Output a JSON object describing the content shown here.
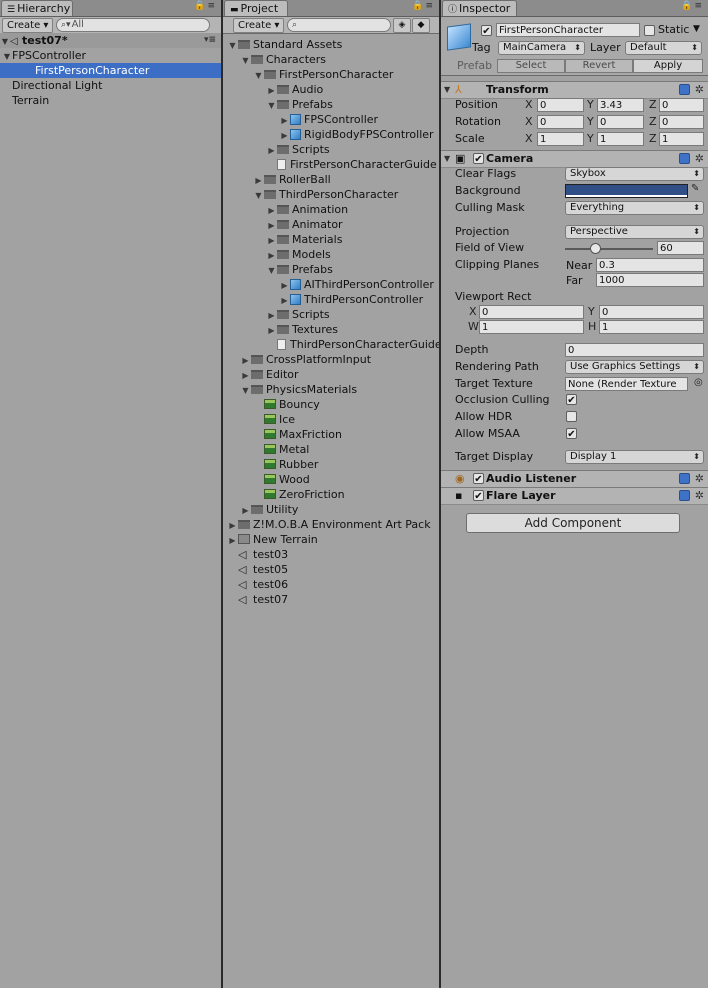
{
  "hierarchy": {
    "tab": "Hierarchy",
    "create": "Create",
    "search_placeholder": "All",
    "scene": "test07*",
    "items": [
      {
        "label": "FPSController",
        "depth": 1,
        "expanded": true
      },
      {
        "label": "FirstPersonCharacter",
        "depth": 2,
        "selected": true
      },
      {
        "label": "Directional Light",
        "depth": 1
      },
      {
        "label": "Terrain",
        "depth": 1
      }
    ]
  },
  "project": {
    "tab": "Project",
    "create": "Create",
    "items": [
      {
        "label": "Standard Assets",
        "kind": "folder",
        "depth": 0,
        "arrow": "down"
      },
      {
        "label": "Characters",
        "kind": "folder",
        "depth": 1,
        "arrow": "down"
      },
      {
        "label": "FirstPersonCharacter",
        "kind": "folder",
        "depth": 2,
        "arrow": "down"
      },
      {
        "label": "Audio",
        "kind": "folder",
        "depth": 3,
        "arrow": "right"
      },
      {
        "label": "Prefabs",
        "kind": "folder",
        "depth": 3,
        "arrow": "down"
      },
      {
        "label": "FPSController",
        "kind": "prefab",
        "depth": 4,
        "arrow": "right"
      },
      {
        "label": "RigidBodyFPSController",
        "kind": "prefab",
        "depth": 4,
        "arrow": "right"
      },
      {
        "label": "Scripts",
        "kind": "folder",
        "depth": 3,
        "arrow": "right"
      },
      {
        "label": "FirstPersonCharacterGuide",
        "kind": "doc",
        "depth": 3,
        "arrow": ""
      },
      {
        "label": "RollerBall",
        "kind": "folder",
        "depth": 2,
        "arrow": "right"
      },
      {
        "label": "ThirdPersonCharacter",
        "kind": "folder",
        "depth": 2,
        "arrow": "down"
      },
      {
        "label": "Animation",
        "kind": "folder",
        "depth": 3,
        "arrow": "right"
      },
      {
        "label": "Animator",
        "kind": "folder",
        "depth": 3,
        "arrow": "right"
      },
      {
        "label": "Materials",
        "kind": "folder",
        "depth": 3,
        "arrow": "right"
      },
      {
        "label": "Models",
        "kind": "folder",
        "depth": 3,
        "arrow": "right"
      },
      {
        "label": "Prefabs",
        "kind": "folder",
        "depth": 3,
        "arrow": "down"
      },
      {
        "label": "AIThirdPersonController",
        "kind": "prefab",
        "depth": 4,
        "arrow": "right"
      },
      {
        "label": "ThirdPersonController",
        "kind": "prefab",
        "depth": 4,
        "arrow": "right"
      },
      {
        "label": "Scripts",
        "kind": "folder",
        "depth": 3,
        "arrow": "right"
      },
      {
        "label": "Textures",
        "kind": "folder",
        "depth": 3,
        "arrow": "right"
      },
      {
        "label": "ThirdPersonCharacterGuide",
        "kind": "doc",
        "depth": 3,
        "arrow": ""
      },
      {
        "label": "CrossPlatformInput",
        "kind": "folder",
        "depth": 1,
        "arrow": "right"
      },
      {
        "label": "Editor",
        "kind": "folder",
        "depth": 1,
        "arrow": "right"
      },
      {
        "label": "PhysicsMaterials",
        "kind": "folder",
        "depth": 1,
        "arrow": "down"
      },
      {
        "label": "Bouncy",
        "kind": "phys",
        "depth": 2,
        "arrow": ""
      },
      {
        "label": "Ice",
        "kind": "phys",
        "depth": 2,
        "arrow": ""
      },
      {
        "label": "MaxFriction",
        "kind": "phys",
        "depth": 2,
        "arrow": ""
      },
      {
        "label": "Metal",
        "kind": "phys",
        "depth": 2,
        "arrow": ""
      },
      {
        "label": "Rubber",
        "kind": "phys",
        "depth": 2,
        "arrow": ""
      },
      {
        "label": "Wood",
        "kind": "phys",
        "depth": 2,
        "arrow": ""
      },
      {
        "label": "ZeroFriction",
        "kind": "phys",
        "depth": 2,
        "arrow": ""
      },
      {
        "label": "Utility",
        "kind": "folder",
        "depth": 1,
        "arrow": "right"
      },
      {
        "label": "Z!M.O.B.A Environment Art Pack",
        "kind": "folder",
        "depth": 0,
        "arrow": "right"
      },
      {
        "label": "New Terrain",
        "kind": "terrain",
        "depth": 0,
        "arrow": "right"
      },
      {
        "label": "test03",
        "kind": "scene",
        "depth": 0,
        "arrow": ""
      },
      {
        "label": "test05",
        "kind": "scene",
        "depth": 0,
        "arrow": ""
      },
      {
        "label": "test06",
        "kind": "scene",
        "depth": 0,
        "arrow": ""
      },
      {
        "label": "test07",
        "kind": "scene",
        "depth": 0,
        "arrow": ""
      }
    ]
  },
  "inspector": {
    "tab": "Inspector",
    "object_name": "FirstPersonCharacter",
    "static_label": "Static",
    "tag_label": "Tag",
    "tag_value": "MainCamera",
    "layer_label": "Layer",
    "layer_value": "Default",
    "prefab_label": "Prefab",
    "prefab_select": "Select",
    "prefab_revert": "Revert",
    "prefab_apply": "Apply",
    "transform": {
      "title": "Transform",
      "position_label": "Position",
      "position": {
        "x": "0",
        "y": "3.43",
        "z": "0"
      },
      "rotation_label": "Rotation",
      "rotation": {
        "x": "0",
        "y": "0",
        "z": "0"
      },
      "scale_label": "Scale",
      "scale": {
        "x": "1",
        "y": "1",
        "z": "1"
      }
    },
    "camera": {
      "title": "Camera",
      "clear_flags_label": "Clear Flags",
      "clear_flags": "Skybox",
      "background_label": "Background",
      "background_color": "#2f4f86",
      "culling_mask_label": "Culling Mask",
      "culling_mask": "Everything",
      "projection_label": "Projection",
      "projection": "Perspective",
      "fov_label": "Field of View",
      "fov": "60",
      "clipping_label": "Clipping Planes",
      "near_label": "Near",
      "near": "0.3",
      "far_label": "Far",
      "far": "1000",
      "viewport_label": "Viewport Rect",
      "vp_x": "0",
      "vp_y": "0",
      "vp_w": "1",
      "vp_h": "1",
      "depth_label": "Depth",
      "depth": "0",
      "rendering_path_label": "Rendering Path",
      "rendering_path": "Use Graphics Settings",
      "target_texture_label": "Target Texture",
      "target_texture": "None (Render Texture",
      "occlusion_label": "Occlusion Culling",
      "occlusion": true,
      "hdr_label": "Allow HDR",
      "hdr": false,
      "msaa_label": "Allow MSAA",
      "msaa": true,
      "target_display_label": "Target Display",
      "target_display": "Display 1"
    },
    "audio_listener": {
      "title": "Audio Listener"
    },
    "flare_layer": {
      "title": "Flare Layer"
    },
    "add_component": "Add Component"
  }
}
